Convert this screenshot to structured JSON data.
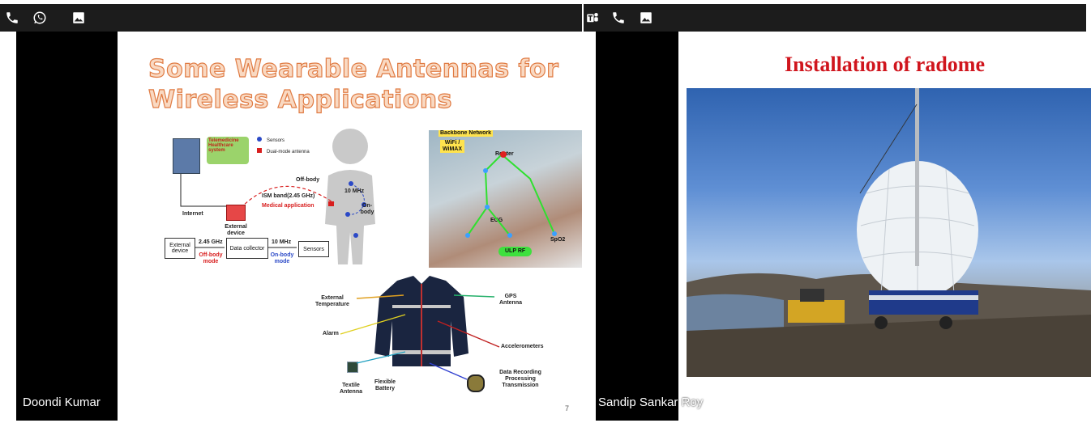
{
  "participants": [
    {
      "name": "Doondi Kumar",
      "slide": {
        "title": "Some Wearable Antennas for Wireless Applications",
        "page_number": "7",
        "diagram": {
          "legend": [
            "Sensors",
            "Dual-mode antenna"
          ],
          "telemedicine": "Telemedicine Healthcare system",
          "internet": "Internet",
          "external_device": "External device",
          "ism_band": "ISM band(2.45 GHz)",
          "medical_application": "Medical application",
          "off_body": "Off-body",
          "on_body": "On-body",
          "freq_10mhz": "10 MHz",
          "flow": {
            "box1": "External device",
            "arrow1": "2.45 GHz",
            "mode1": "Off-body mode",
            "box2": "Data collector",
            "arrow2": "10 MHz",
            "mode2": "On-body mode",
            "box3": "Sensors"
          }
        },
        "photo_labels": [
          "Backbone Network",
          "WiFi / WiMAX",
          "Router",
          "ECG",
          "SpO2",
          "ULP RF"
        ],
        "jacket_labels": {
          "external_temperature": "External Temperature",
          "gps_antenna": "GPS Antenna",
          "alarm": "Alarm",
          "accelerometers": "Accelerometers",
          "textile_antenna": "Textile Antenna",
          "flexible_battery": "Flexible Battery",
          "data": "Data Recording Processing Transmission"
        }
      }
    },
    {
      "name": "Sandip Sankar Roy",
      "slide": {
        "title": "Installation of radome"
      }
    }
  ],
  "colors": {
    "title_orange": "#e07b43",
    "title_red": "#d0151d",
    "tile_bg": "#000000",
    "bar_bg": "#1c1c1c"
  },
  "icons": [
    "phone-icon",
    "whatsapp-icon",
    "gallery-icon",
    "teams-icon"
  ]
}
